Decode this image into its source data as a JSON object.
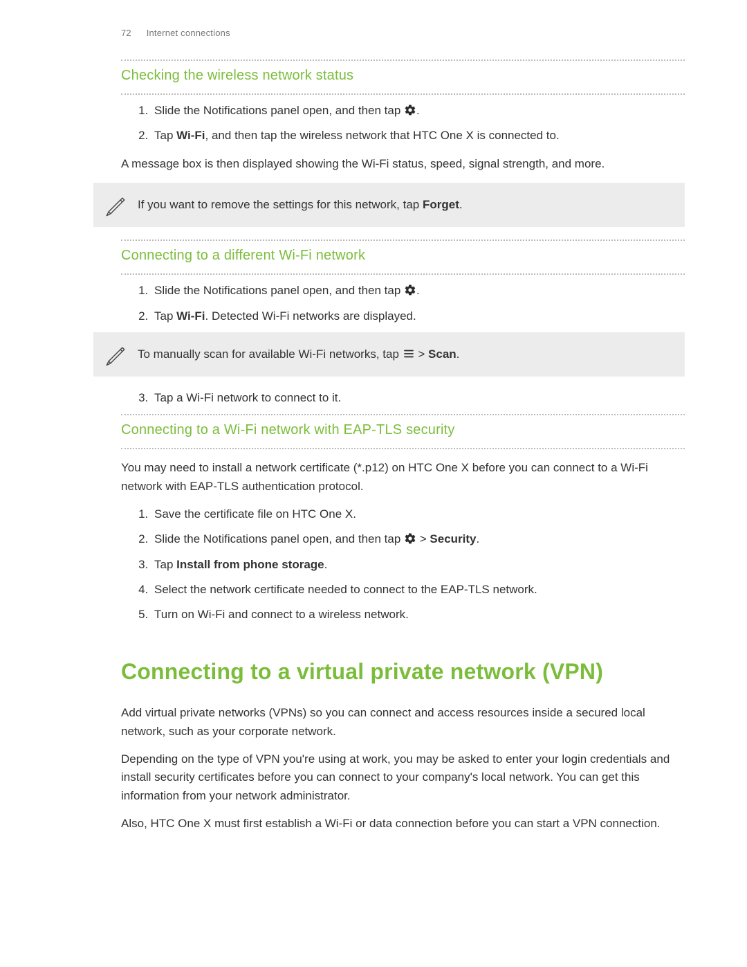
{
  "header": {
    "page_number": "72",
    "chapter": "Internet connections"
  },
  "sec1": {
    "title": "Checking the wireless network status",
    "step1_a": "Slide the Notifications panel open, and then tap ",
    "step1_b": ".",
    "step2_a": "Tap ",
    "step2_wifi": "Wi-Fi",
    "step2_b": ", and then tap the wireless network that HTC One X is connected to.",
    "after": "A message box is then displayed showing the Wi-Fi status, speed, signal strength, and more.",
    "note_a": "If you want to remove the settings for this network, tap ",
    "note_forget": "Forget",
    "note_b": "."
  },
  "sec2": {
    "title": "Connecting to a different Wi-Fi network",
    "step1_a": "Slide the Notifications panel open, and then tap ",
    "step1_b": ".",
    "step2_a": "Tap ",
    "step2_wifi": "Wi-Fi",
    "step2_b": ". Detected Wi-Fi networks are displayed.",
    "note_a": "To manually scan for available Wi-Fi networks, tap ",
    "note_b": " > ",
    "note_scan": "Scan",
    "note_c": ".",
    "step3": "Tap a Wi-Fi network to connect to it."
  },
  "sec3": {
    "title": "Connecting to a Wi-Fi network with EAP-TLS security",
    "intro": "You may need to install a network certificate (*.p12) on HTC One X before you can connect to a Wi-Fi network with EAP-TLS authentication protocol.",
    "step1": "Save the certificate file on HTC One X.",
    "step2_a": "Slide the Notifications panel open, and then tap ",
    "step2_b": " > ",
    "step2_sec": "Security",
    "step2_c": ".",
    "step3_a": "Tap ",
    "step3_install": "Install from phone storage",
    "step3_b": ".",
    "step4": "Select the network certificate needed to connect to the EAP-TLS network.",
    "step5": "Turn on Wi-Fi and connect to a wireless network."
  },
  "sec4": {
    "title": "Connecting to a virtual private network (VPN)",
    "p1": "Add virtual private networks (VPNs) so you can connect and access resources inside a secured local network, such as your corporate network.",
    "p2": "Depending on the type of VPN you're using at work, you may be asked to enter your login credentials and install security certificates before you can connect to your company's local network. You can get this information from your network administrator.",
    "p3": "Also, HTC One X must first establish a Wi-Fi or data connection before you can start a VPN connection."
  },
  "icons": {
    "settings": "settings-icon",
    "menu": "menu-icon",
    "pencil": "pencil-note-icon"
  }
}
